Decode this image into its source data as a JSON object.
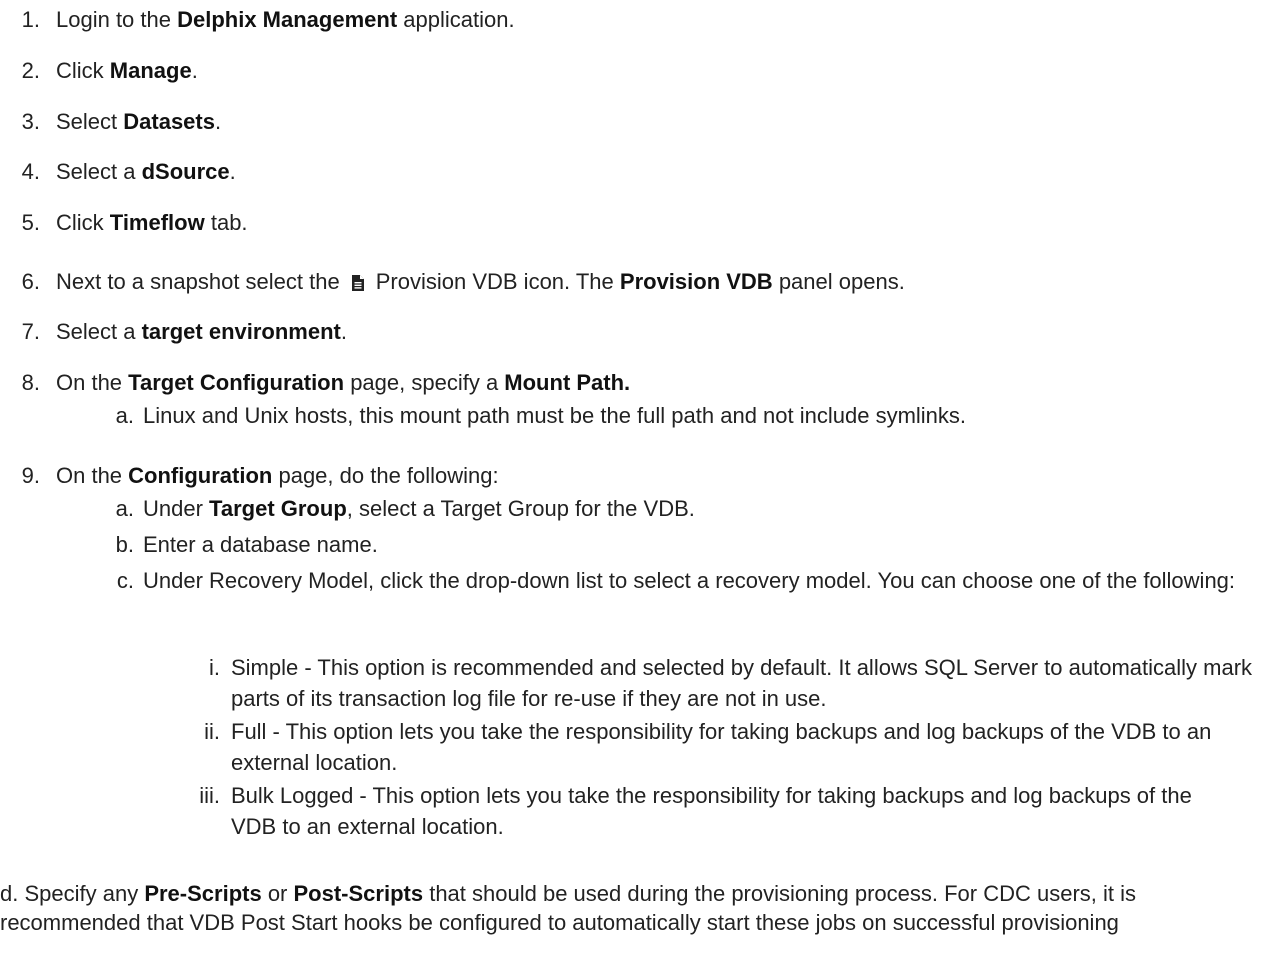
{
  "steps": [
    {
      "n": "1.",
      "pre": "Login to the ",
      "b1": "Delphix Management",
      "post": " application."
    },
    {
      "n": "2.",
      "pre": "Click ",
      "b1": "Manage",
      "post": "."
    },
    {
      "n": "3.",
      "pre": "Select ",
      "b1": "Datasets",
      "post": "."
    },
    {
      "n": "4.",
      "pre": "Select a ",
      "b1": "dSource",
      "post": "."
    },
    {
      "n": "5.",
      "pre": "Click ",
      "b1": "Timeflow",
      "post": " tab."
    },
    {
      "n": "6.",
      "pre": "Next to a snapshot select the",
      "icon": "file-icon",
      "mid": "Provision VDB icon. The ",
      "b1": "Provision VDB",
      "post": " panel opens."
    },
    {
      "n": "7.",
      "pre": "Select a ",
      "b1": "target environment",
      "post": "."
    },
    {
      "n": "8.",
      "pre": "On the ",
      "b1": "Target Configuration",
      "mid": " page, specify a ",
      "b2": "Mount Path."
    },
    {
      "n": "9.",
      "pre": "On the ",
      "b1": "Configuration",
      "post": " page, do the following:"
    }
  ],
  "step8_sub": {
    "letter": "a.",
    "text": "Linux and Unix hosts, this mount path must be the full path and not include symlinks."
  },
  "step9_sub": [
    {
      "letter": "a.",
      "pre": "Under ",
      "b1": "Target Group",
      "post": ", select a Target Group for the VDB."
    },
    {
      "letter": "b.",
      "text": "Enter a database name."
    },
    {
      "letter": "c.",
      "text": "Under Recovery Model, click the drop-down list to select a recovery model. You can choose one of the following:"
    }
  ],
  "recovery_models": [
    {
      "roman": "i.",
      "text": "Simple - This option is recommended and selected by default. It allows SQL Server to automatically mark parts of its transaction log file for re-use if they are not in use."
    },
    {
      "roman": "ii.",
      "text": "Full - This option lets you take the responsibility for taking backups and log backups of the VDB to an external location."
    },
    {
      "roman": "iii.",
      "text": "Bulk Logged - This option lets you take the responsibility for taking backups and log backups of the VDB to an external location."
    }
  ],
  "step_d": {
    "pre": "d. Specify any ",
    "b1": "Pre-Scripts",
    "mid": " or ",
    "b2": "Post-Scripts",
    "post": " that should be used during the provisioning process. For CDC users, it is recommended that VDB Post Start hooks be configured to automatically start these jobs on successful provisioning"
  }
}
